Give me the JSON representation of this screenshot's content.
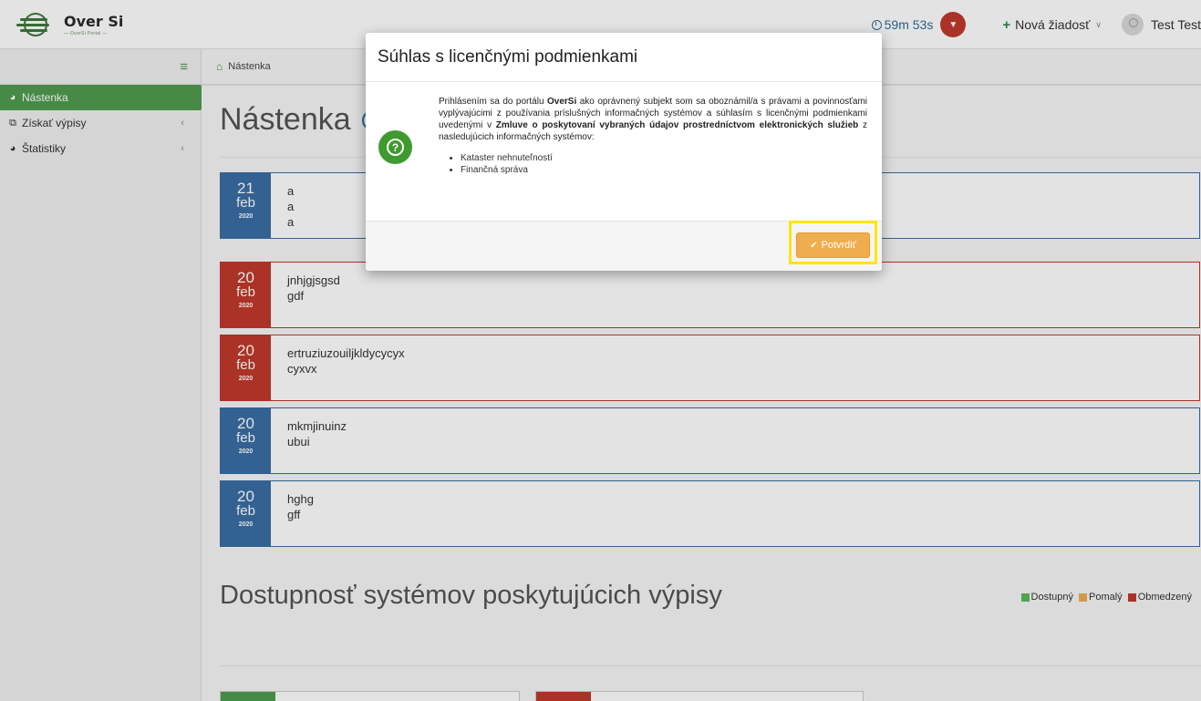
{
  "header": {
    "logo_name": "Over Si",
    "logo_sub": "— OverSi Portal —",
    "timer": "59m 53s",
    "new_request": "Nová žiadosť",
    "user_name": "Test Test"
  },
  "sidebar": {
    "items": [
      {
        "label": "Nástenka",
        "icon": "dashboard-icon",
        "active": true
      },
      {
        "label": "Získať výpisy",
        "icon": "copy-icon",
        "active": false
      },
      {
        "label": "Štatistiky",
        "icon": "dashboard-icon",
        "active": false
      }
    ]
  },
  "breadcrumb": {
    "label": "Nástenka"
  },
  "page": {
    "title": "Nástenka",
    "messages": [
      {
        "day": "21",
        "month": "feb",
        "year": "2020",
        "lines": [
          "a",
          "a",
          "a"
        ],
        "color": "#3a6ea5"
      },
      {
        "day": "20",
        "month": "feb",
        "year": "2020",
        "lines": [
          "jnhjgjsgsd",
          "gdf"
        ],
        "color": "#c0392b"
      },
      {
        "day": "20",
        "month": "feb",
        "year": "2020",
        "lines": [
          "ertruziuzouiljkldycycyx",
          "cyxvx"
        ],
        "color": "#c0392b"
      },
      {
        "day": "20",
        "month": "feb",
        "year": "2020",
        "lines": [
          "mkmjinuinz",
          "ubui"
        ],
        "color": "#3a6ea5"
      },
      {
        "day": "20",
        "month": "feb",
        "year": "2020",
        "lines": [
          "hghg",
          "gff"
        ],
        "color": "#3a6ea5"
      }
    ],
    "section_title": "Dostupnosť systémov poskytujúcich výpisy",
    "legend": {
      "available": "Dostupný",
      "slow": "Pomalý",
      "limited": "Obmedzený"
    }
  },
  "modal": {
    "title": "Súhlas s licenčnými podmienkami",
    "text_1": "Prihlásením sa do portálu ",
    "text_brand": "OverSi",
    "text_2": " ako oprávnený subjekt som sa oboznámil/a s právami a povinnosťami vyplývajúcimi z používania príslušných informačných systémov a súhlasím s licenčnými podmienkami uvedenými v ",
    "text_bold": "Zmluve o poskytovaní vybraných údajov prostredníctvom elektronických služieb",
    "text_3": " z nasledujúcich informačných systémov:",
    "systems": [
      "Kataster nehnuteľností",
      "Finančná správa"
    ],
    "confirm_label": "Potvrdiť"
  },
  "colors": {
    "accent_green": "#4f9c4f",
    "blue": "#3a6ea5",
    "red": "#c0392b",
    "confirm": "#f0ad4e",
    "highlight": "#ffe600"
  }
}
